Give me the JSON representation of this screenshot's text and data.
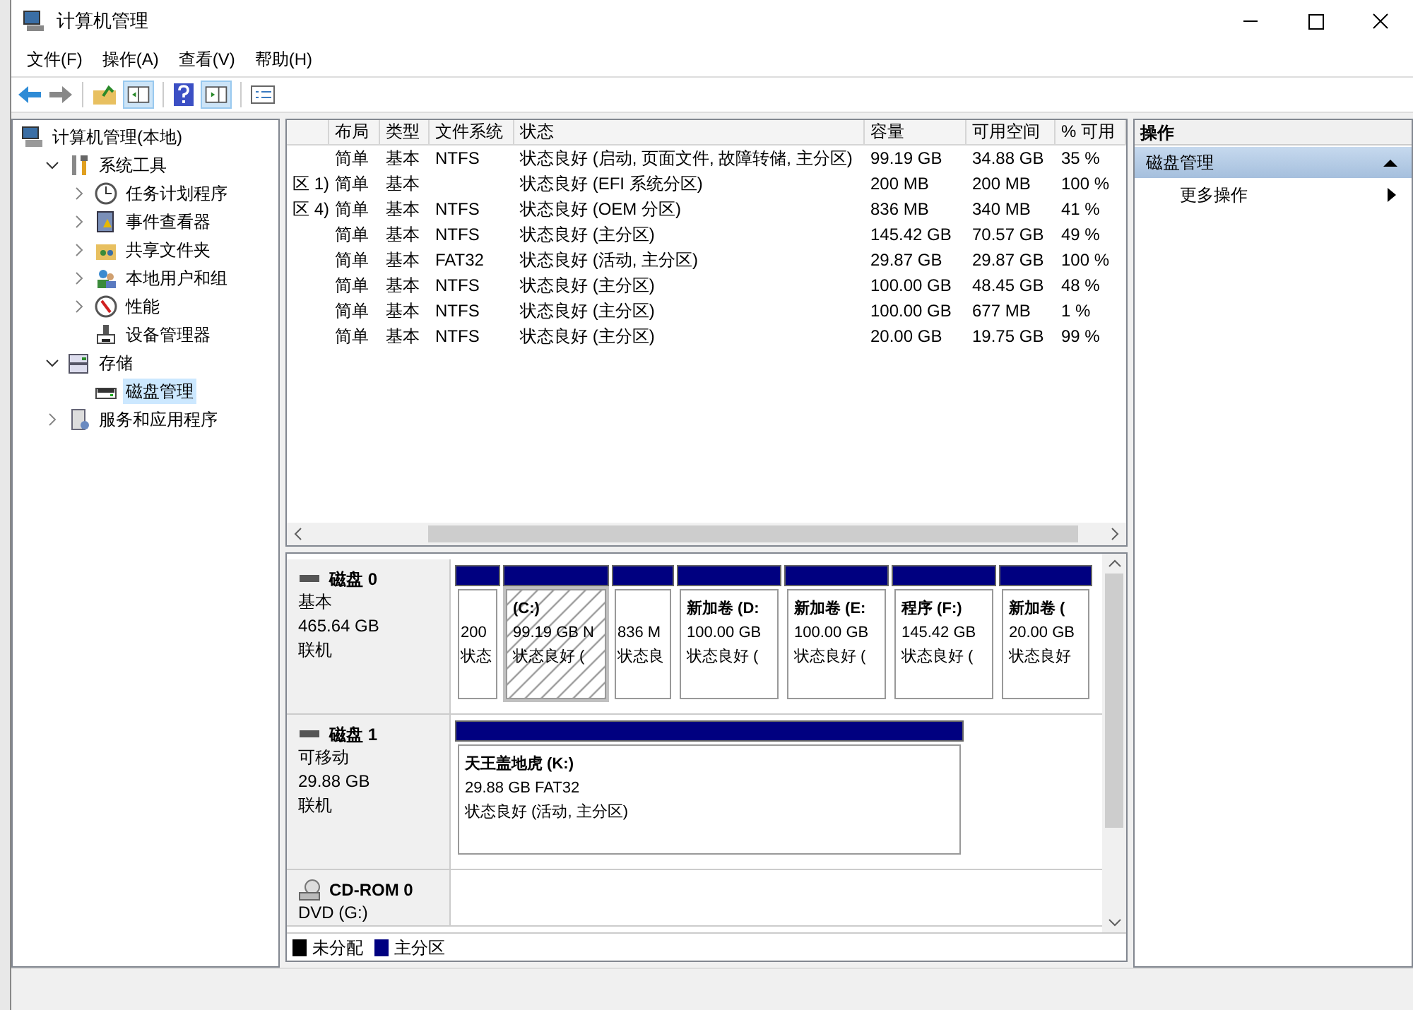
{
  "window": {
    "title": "计算机管理"
  },
  "menu": [
    {
      "label": "文件(F)"
    },
    {
      "label": "操作(A)"
    },
    {
      "label": "查看(V)"
    },
    {
      "label": "帮助(H)"
    }
  ],
  "tree": [
    {
      "label": "计算机管理(本地)",
      "selected": false,
      "children": [
        {
          "label": "系统工具",
          "expanded": true,
          "selected": false,
          "children": [
            {
              "label": "任务计划程序",
              "expanded": false,
              "selected": false
            },
            {
              "label": "事件查看器",
              "expanded": false,
              "selected": false
            },
            {
              "label": "共享文件夹",
              "expanded": false,
              "selected": false
            },
            {
              "label": "本地用户和组",
              "expanded": false,
              "selected": false
            },
            {
              "label": "性能",
              "expanded": false,
              "selected": false
            },
            {
              "label": "设备管理器",
              "selected": false
            }
          ]
        },
        {
          "label": "存储",
          "expanded": true,
          "selected": false,
          "children": [
            {
              "label": "磁盘管理",
              "selected": true
            }
          ]
        },
        {
          "label": "服务和应用程序",
          "expanded": false,
          "selected": false
        }
      ]
    }
  ],
  "table": {
    "columns": [
      "布局",
      "类型",
      "文件系统",
      "状态",
      "容量",
      "可用空间",
      "% 可用"
    ],
    "rows": [
      {
        "layout": "简单",
        "type": "基本",
        "fs": "NTFS",
        "status": "状态良好 (启动, 页面文件, 故障转储, 主分区)",
        "capacity": "99.19 GB",
        "free": "34.88 GB",
        "pct": "35 %"
      },
      {
        "column_1": "区 1)",
        "layout": "简单",
        "type": "基本",
        "status": "状态良好 (EFI 系统分区)",
        "capacity": "200 MB",
        "free": "200 MB",
        "pct": "100 %"
      },
      {
        "column_1": "区 4)",
        "layout": "简单",
        "type": "基本",
        "fs": "NTFS",
        "status": "状态良好 (OEM 分区)",
        "capacity": "836 MB",
        "free": "340 MB",
        "pct": "41 %"
      },
      {
        "layout": "简单",
        "type": "基本",
        "fs": "NTFS",
        "status": "状态良好 (主分区)",
        "capacity": "145.42 GB",
        "free": "70.57 GB",
        "pct": "49 %"
      },
      {
        "layout": "简单",
        "type": "基本",
        "fs": "FAT32",
        "status": "状态良好 (活动, 主分区)",
        "capacity": "29.87 GB",
        "free": "29.87 GB",
        "pct": "100 %"
      },
      {
        "layout": "简单",
        "type": "基本",
        "fs": "NTFS",
        "status": "状态良好 (主分区)",
        "capacity": "100.00 GB",
        "free": "48.45 GB",
        "pct": "48 %"
      },
      {
        "layout": "简单",
        "type": "基本",
        "fs": "NTFS",
        "status": "状态良好 (主分区)",
        "capacity": "100.00 GB",
        "free": "677 MB",
        "pct": "1 %"
      },
      {
        "layout": "简单",
        "type": "基本",
        "fs": "NTFS",
        "status": "状态良好 (主分区)",
        "capacity": "20.00 GB",
        "free": "19.75 GB",
        "pct": "99 %"
      }
    ]
  },
  "disks": [
    {
      "kind": "disk",
      "name": "磁盘 0",
      "type": "基本",
      "size": "465.64 GB",
      "status": "联机",
      "partitions": [
        {
          "lines": [
            "200",
            "状态"
          ],
          "selected": false
        },
        {
          "name": "(C:)",
          "lines": [
            "99.19 GB N",
            "状态良好 ("
          ],
          "selected": true
        },
        {
          "lines": [
            "836 M",
            "状态良"
          ],
          "selected": false
        },
        {
          "name": "新加卷 (D:",
          "lines": [
            "100.00 GB",
            "状态良好 ("
          ],
          "selected": false
        },
        {
          "name": "新加卷 (E:",
          "lines": [
            "100.00 GB",
            "状态良好 ("
          ],
          "selected": false
        },
        {
          "name": "程序 (F:)",
          "lines": [
            "145.42 GB",
            "状态良好 ("
          ],
          "selected": false
        },
        {
          "name": "新加卷 (",
          "lines": [
            "20.00 GB",
            "状态良好"
          ],
          "selected": false
        }
      ]
    },
    {
      "kind": "disk",
      "name": "磁盘 1",
      "type": "可移动",
      "size": "29.88 GB",
      "status": "联机",
      "partitions": [
        {
          "name": "天王盖地虎 (K:)",
          "lines": [
            "29.88 GB FAT32",
            "状态良好 (活动, 主分区)"
          ],
          "selected": false
        }
      ]
    },
    {
      "kind": "cdrom",
      "name": "CD-ROM 0",
      "type": "DVD (G:)"
    }
  ],
  "legend": [
    {
      "label": "未分配",
      "color": "#000000"
    },
    {
      "label": "主分区",
      "color": "#000080"
    }
  ],
  "actions": {
    "header": "操作",
    "items": [
      {
        "label": "磁盘管理",
        "kind": "section",
        "selected": true
      },
      {
        "label": "更多操作",
        "kind": "submenu",
        "selected": false
      }
    ]
  }
}
